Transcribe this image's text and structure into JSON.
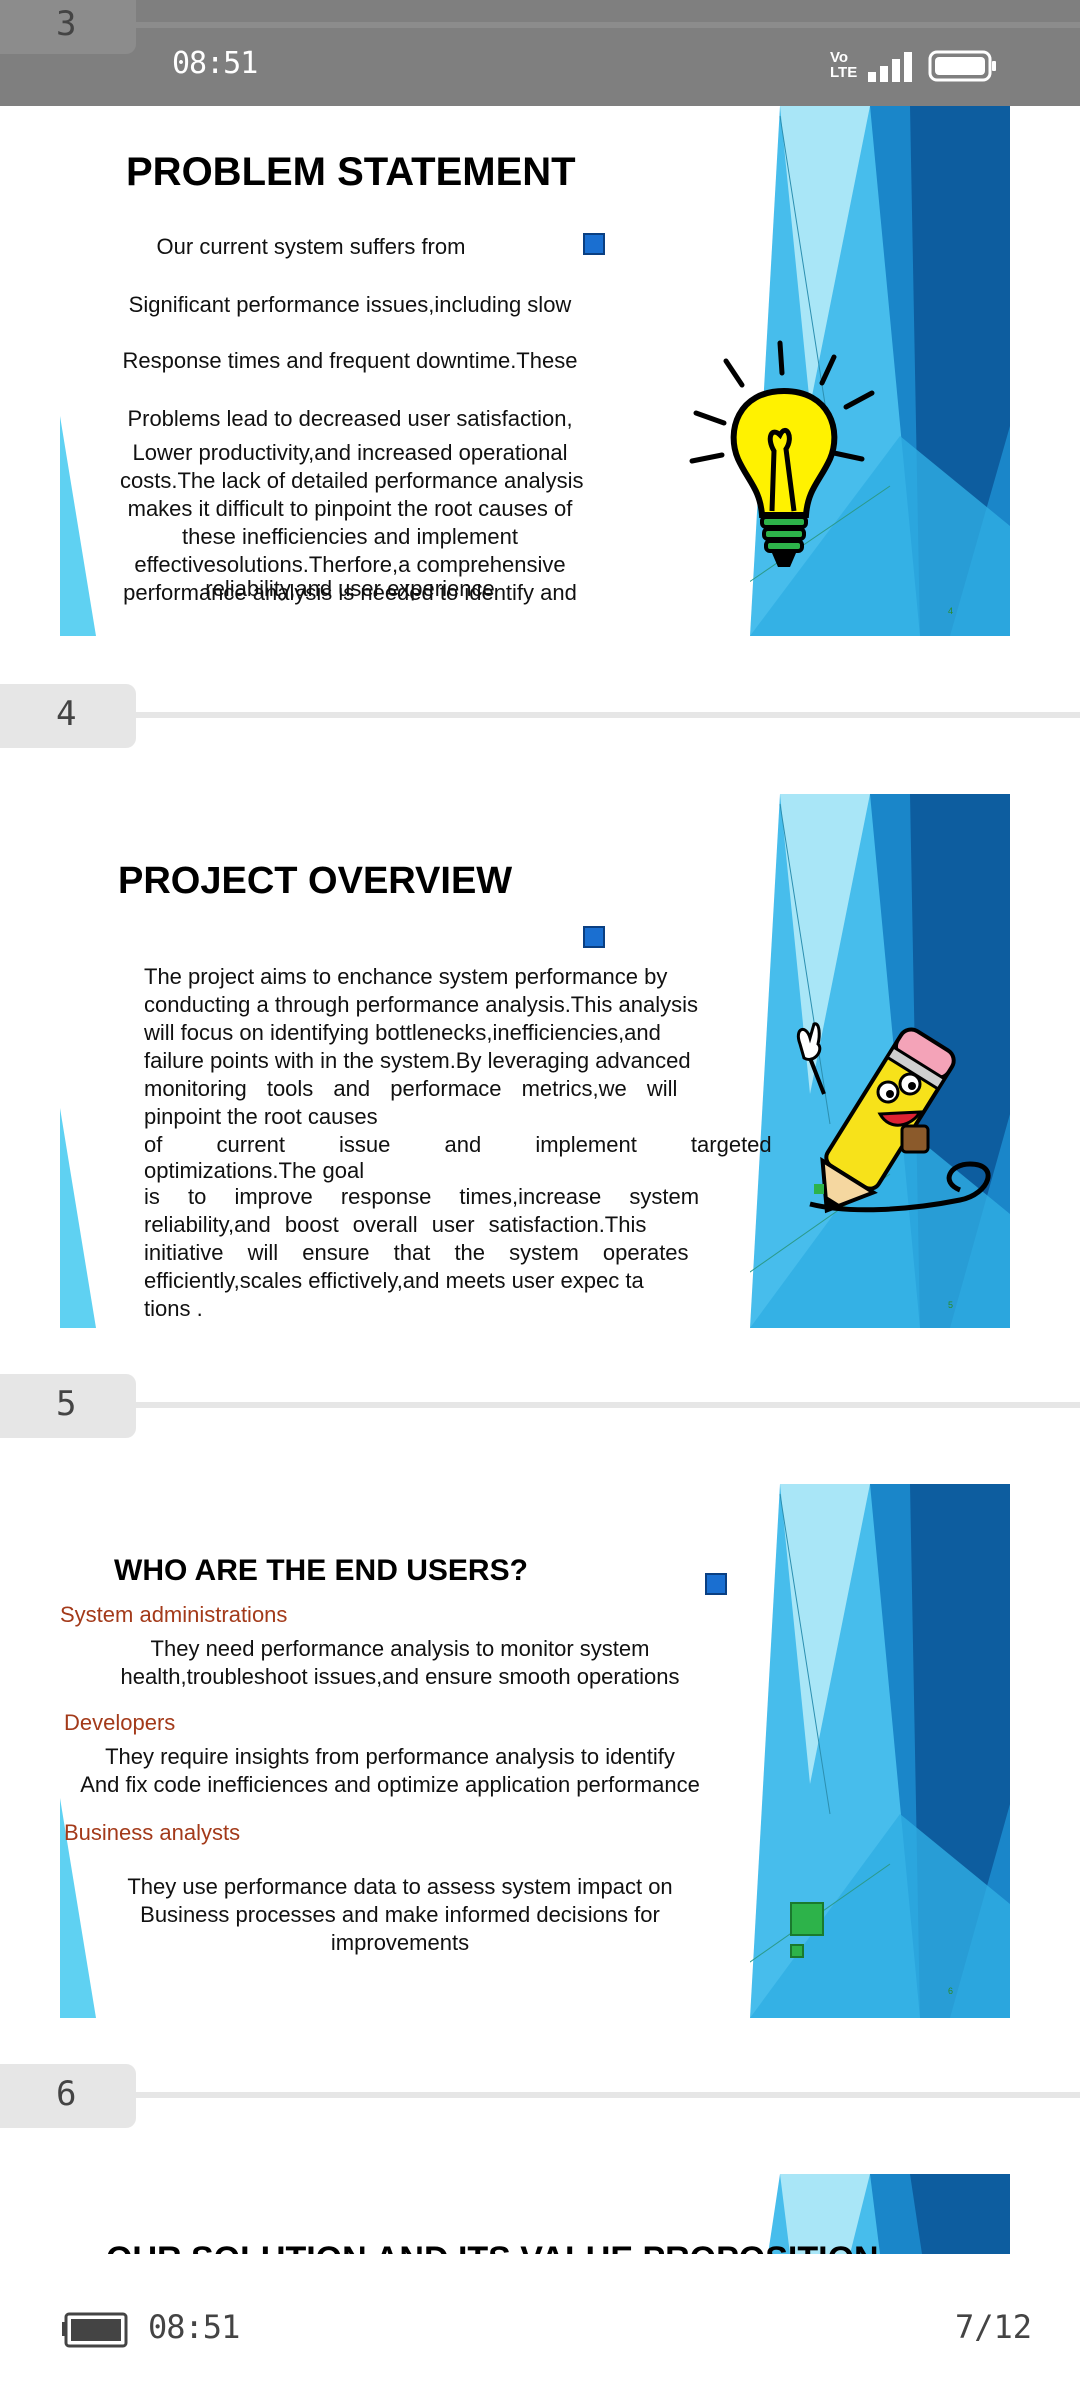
{
  "status_bar": {
    "time": "08:51",
    "network": "Vo LTE"
  },
  "bottom_bar": {
    "time": "08:51",
    "page_indicator": "7/12"
  },
  "page_tabs": [
    "3",
    "4",
    "5",
    "6"
  ],
  "slides": [
    {
      "title": "PROBLEM STATEMENT",
      "lines": [
        "Our current system suffers from",
        "Significant performance issues,including slow",
        "Response times and frequent downtime.These",
        "Problems lead to decreased user satisfaction,",
        "Lower productivity,and increased operational",
        "costs.The lack of detailed performance analysis",
        "makes it difficult to pinpoint the root causes of",
        "these inefficiencies and implement",
        "effectivesolutions.Therfore,a comprehensive",
        "performance analysis is needed to identify and",
        "reliability,and user experience"
      ],
      "slide_number": "4"
    },
    {
      "title": "PROJECT OVERVIEW",
      "lines": [
        "The project aims to enchance system performance by",
        "conducting a through performance analysis.This analysis",
        "will focus on identifying bottlenecks,inefficiencies,and",
        "failure points with in the system.By leveraging advanced",
        "monitoring tools and performace metrics,we will",
        "pinpoint the root causes",
        "of current issue and implement targeted",
        "optimizations.The goal",
        "is to improve response times,increase system",
        "reliability,and boost overall user satisfaction.This",
        "initiative will ensure that the system operates",
        "efficiently,scales effictively,and meets user expec ta",
        "tions ."
      ],
      "slide_number": "5"
    },
    {
      "title": "WHO ARE THE END USERS?",
      "groups": [
        {
          "heading": "System administrations",
          "lines": [
            "They need performance analysis to monitor system",
            "health,troubleshoot issues,and ensure smooth operations"
          ]
        },
        {
          "heading": "Developers",
          "lines": [
            "They require insights from performance analysis to identify",
            "And fix code inefficiences and optimize application performance"
          ]
        },
        {
          "heading": "Business analysts",
          "lines": [
            "They use performance data to assess system impact on",
            "Business processes and make informed decisions for",
            "improvements"
          ]
        }
      ],
      "slide_number": "6"
    },
    {
      "title": "OUR SOLUTION AND ITS VALUE PROPOSITION"
    }
  ],
  "colors": {
    "accent_blue": "#1a6fd1",
    "heading_red": "#a33a1a",
    "status_bar": "#7f7f7f",
    "green": "#2db34a"
  },
  "icons": [
    "lightbulb-icon",
    "pencil-character-icon",
    "battery-icon",
    "signal-icon"
  ]
}
